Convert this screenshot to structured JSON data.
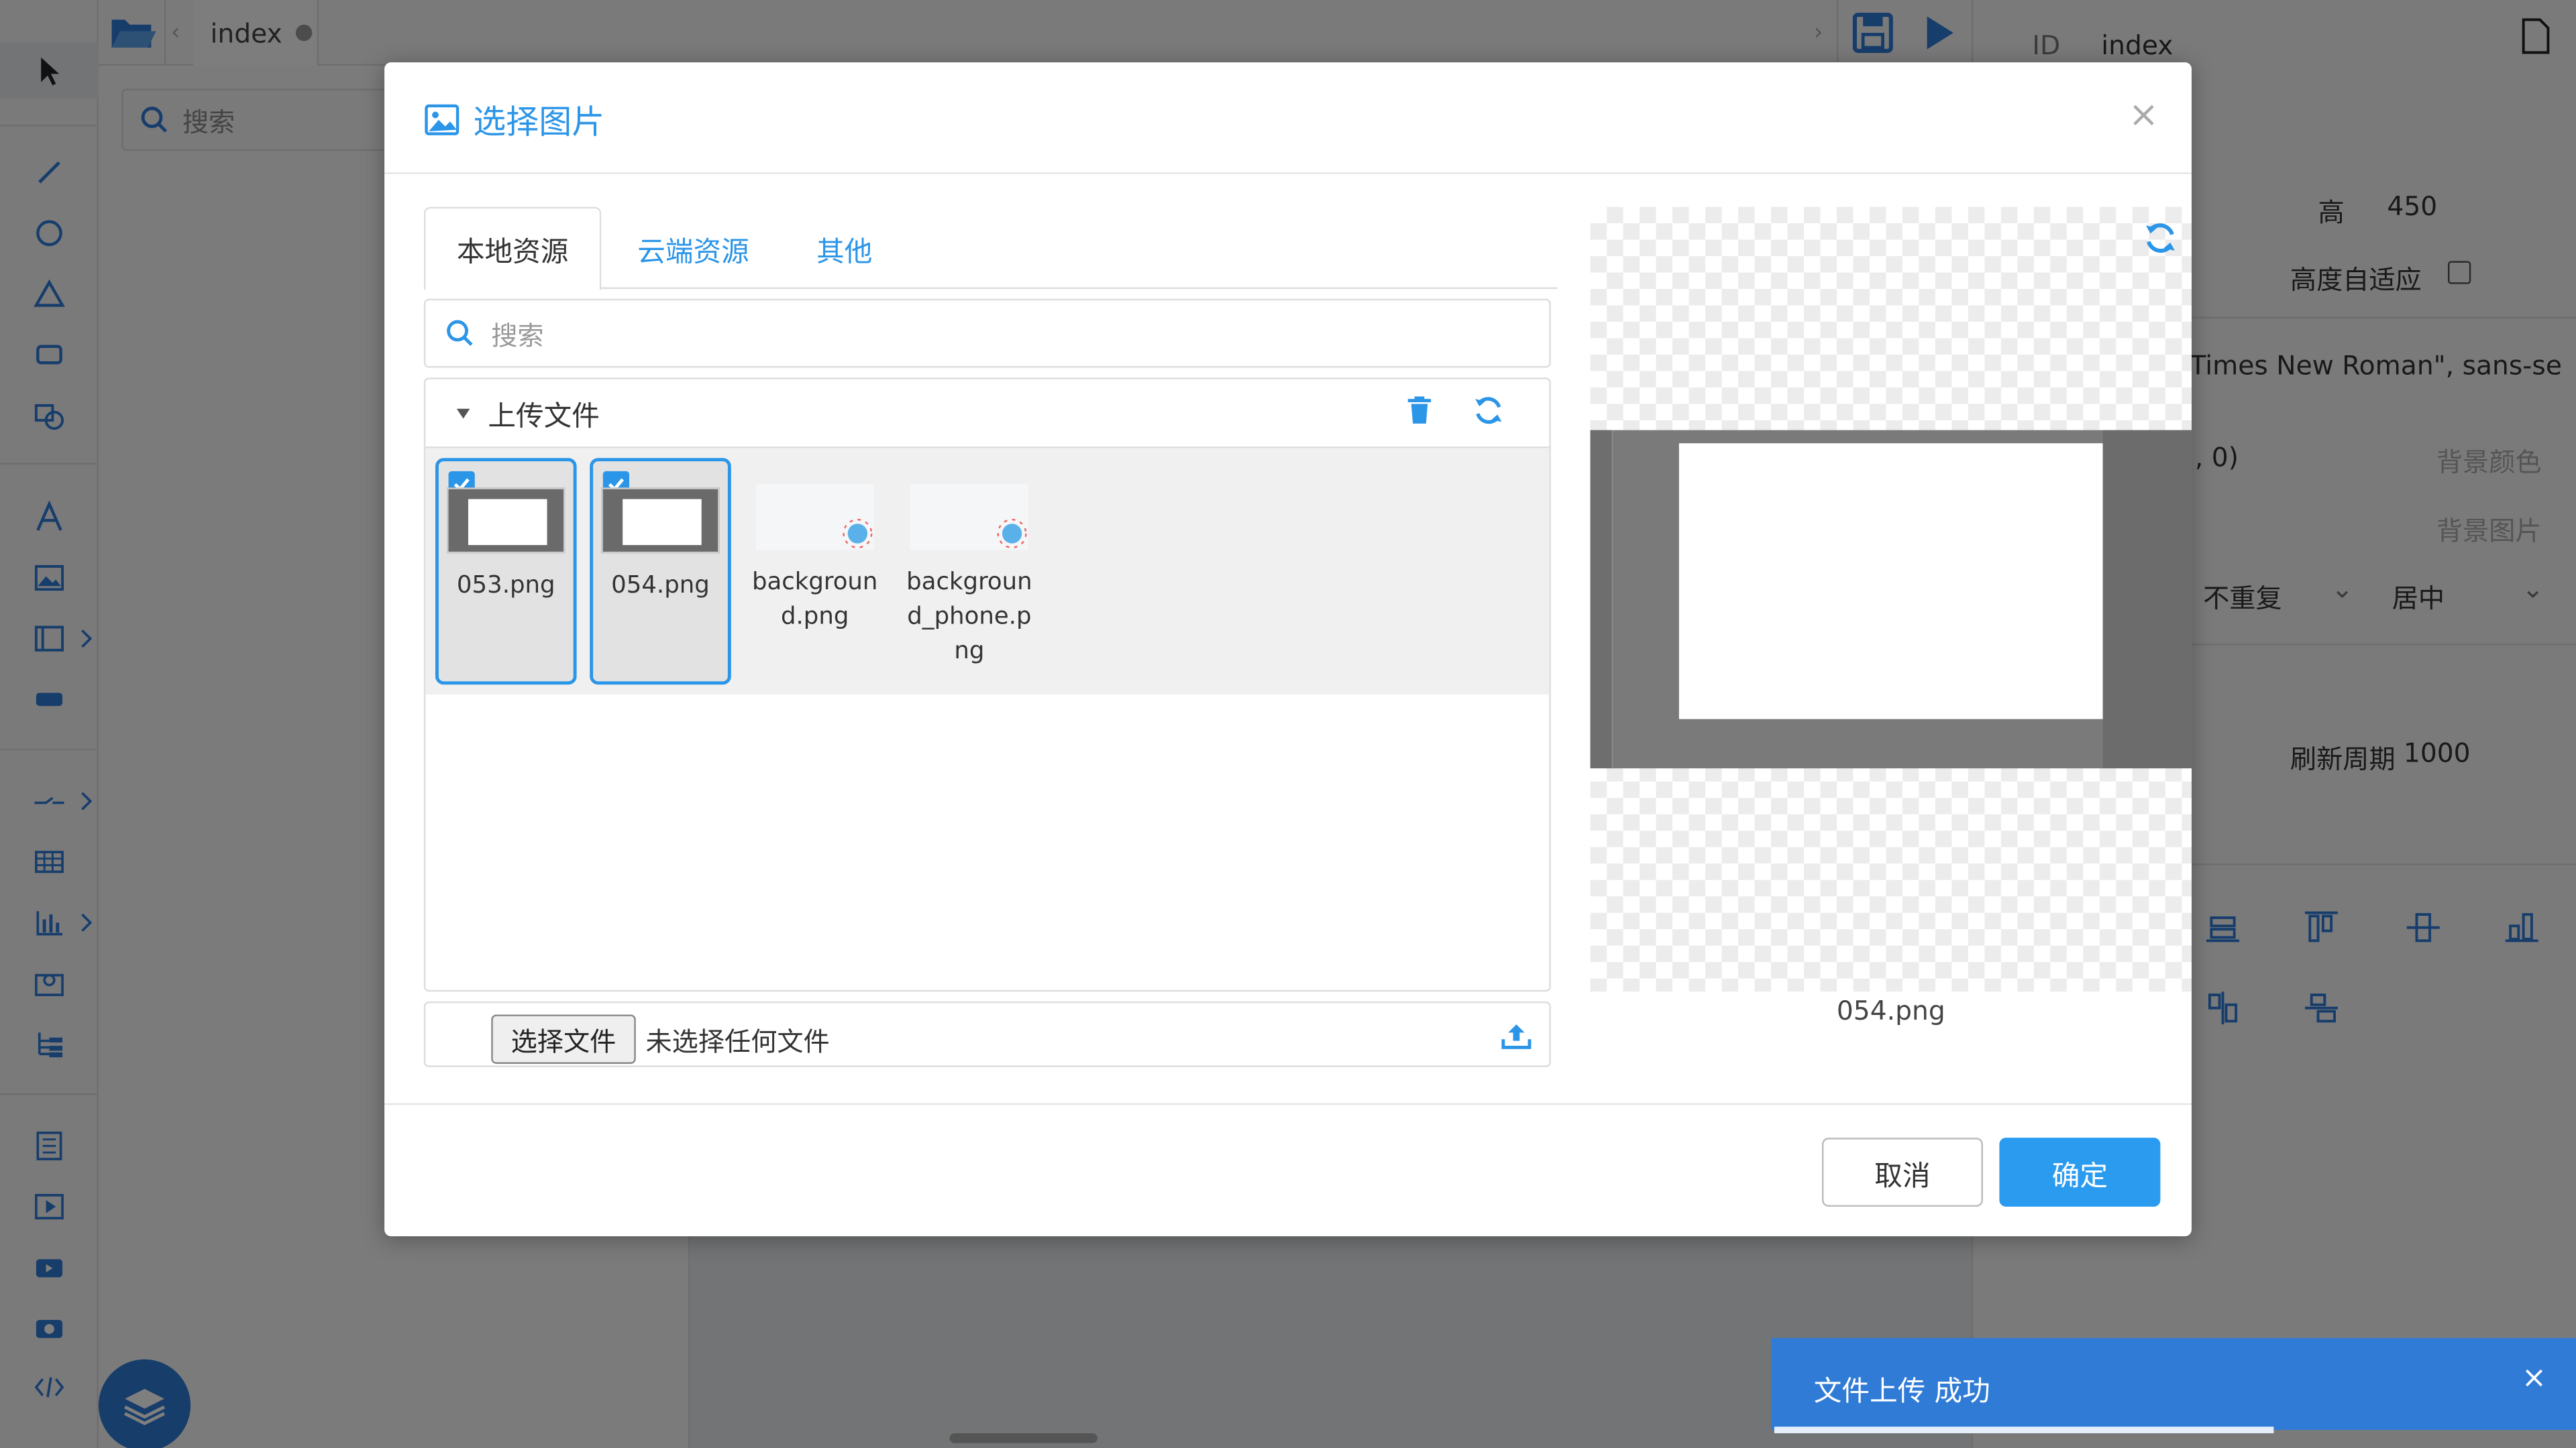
{
  "editor": {
    "file_tab": "index",
    "left_search_placeholder": "搜索"
  },
  "right_panel": {
    "id_label": "ID",
    "id_value": "index",
    "height_label": "高",
    "height_value": "450",
    "auto_height_label": "高度自适应",
    "font_value": "Times New Roman\", sans-se",
    "rgba_fragment": ", 0)",
    "bg_color_label": "背景颜色",
    "bg_image_label": "背景图片",
    "repeat_value": "不重复",
    "position_value": "居中",
    "refresh_label": "刷新周期",
    "refresh_value": "1000"
  },
  "dialog": {
    "title": "选择图片",
    "close": "×",
    "tabs": [
      {
        "label": "本地资源",
        "active": true
      },
      {
        "label": "云端资源",
        "active": false
      },
      {
        "label": "其他",
        "active": false
      }
    ],
    "search_placeholder": "搜索",
    "folder_label": "上传文件",
    "files": [
      {
        "name": "053.png",
        "selected": true
      },
      {
        "name": "054.png",
        "selected": true
      },
      {
        "name": "background.png",
        "selected": false
      },
      {
        "name": "background_phone.png",
        "selected": false
      }
    ],
    "choose_file_label": "选择文件",
    "no_file_text": "未选择任何文件",
    "preview_name": "054.png",
    "cancel_label": "取消",
    "ok_label": "确定"
  },
  "toast": {
    "message": "文件上传 成功",
    "close": "×",
    "progress": 0.62
  },
  "colors": {
    "accent": "#2b95e8",
    "toast": "#2f7bd6"
  }
}
